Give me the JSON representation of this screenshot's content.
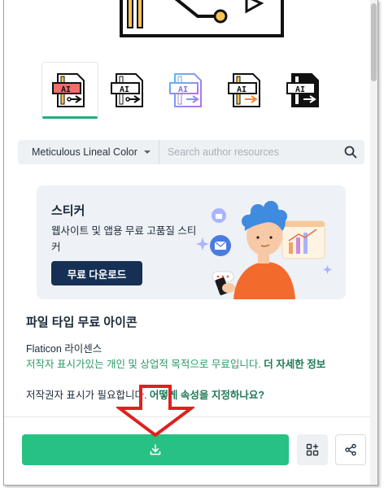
{
  "search": {
    "style_label": "Meticulous Lineal Color",
    "placeholder": "Search author resources"
  },
  "variants": [
    {
      "style": "lineal-color",
      "text": "AI",
      "selected": true
    },
    {
      "style": "lineal",
      "text": "AI",
      "selected": false
    },
    {
      "style": "gradient",
      "text": "AI",
      "selected": false
    },
    {
      "style": "color-accent",
      "text": "AI",
      "selected": false
    },
    {
      "style": "fill",
      "text": "AI",
      "selected": false
    }
  ],
  "banner": {
    "title": "스티커",
    "description": "웹사이트 및 앱용 무료 고품질 스티커",
    "button_label": "무료 다운로드"
  },
  "info": {
    "title": "파일 타입 무료 아이콘",
    "license_label": "Flaticon 라이센스",
    "license_desc": "저작자 표시가있는 개인 및 상업적 목적으로 무료입니다. ",
    "more_info_link": "더 자세한 정보",
    "attribution_question": "저작권자 표시가 필요합니다. ",
    "attribution_link": "어떻게 속성을 지정하나요?"
  },
  "colors": {
    "accent_green": "#27c183",
    "navy": "#163055",
    "annotation_red": "#e02020"
  },
  "icons": {
    "download": "download-icon",
    "collection": "add-to-collection-icon",
    "share": "share-icon",
    "search": "search-icon"
  }
}
